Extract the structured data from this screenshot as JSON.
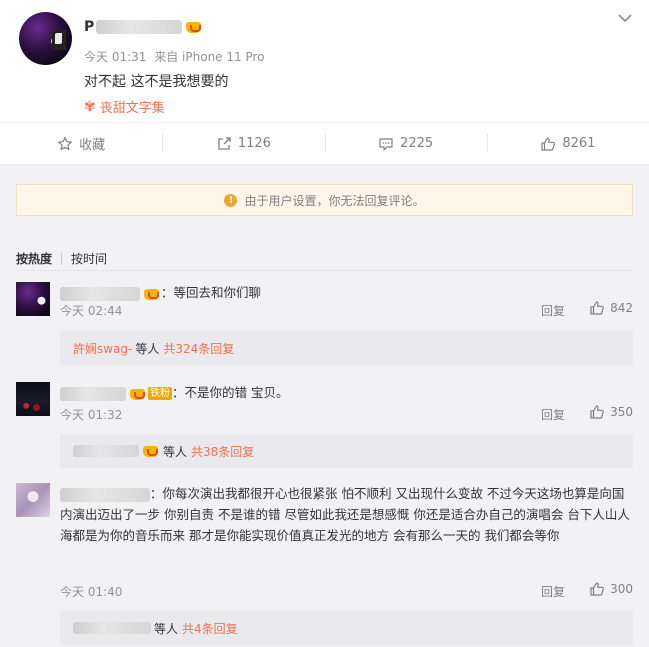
{
  "post": {
    "name_first_char": "P",
    "post_time": "今天 01:31",
    "post_source": "来自 iPhone 11 Pro",
    "text": "对不起 这不是我想要的",
    "topic": "丧甜文字集",
    "menu_icon": "chevron-down-icon"
  },
  "actions": {
    "favorite_label": "收藏",
    "repost_count": "1126",
    "comment_count": "2225",
    "like_count": "8261"
  },
  "notice": {
    "icon": "!",
    "text": "由于用户设置，你无法回复评论。"
  },
  "sort": {
    "hot_label": "按热度",
    "time_label": "按时间"
  },
  "comments": [
    {
      "text": "：等回去和你们聊",
      "time": "今天 02:44",
      "reply_label": "回复",
      "likes": "842",
      "sub_user": "許娴swag-",
      "sub_mid": "等人",
      "sub_count": "共324条回复"
    },
    {
      "badge": "铁粉",
      "text": "：不是你的错 宝贝。",
      "time": "今天 01:32",
      "reply_label": "回复",
      "likes": "350",
      "sub_mid": "等人",
      "sub_count": "共38条回复"
    },
    {
      "text": "：你每次演出我都很开心也很紧张 怕不顺利 又出现什么变故 不过今天这场也算是向国内演出迈出了一步 你别自责 不是谁的错 尽管如此我还是想感慨 你还是适合办自己的演唱会 台下人山人海都是为你的音乐而来 那才是你能实现价值真正发光的地方 会有那么一天的 我们都会等你",
      "time": "今天 01:40",
      "reply_label": "回复",
      "likes": "300",
      "sub_mid": "等人",
      "sub_count": "共4条回复"
    }
  ],
  "colors": {
    "accent": "#eb7350",
    "notice_bg": "#fdf6e9",
    "page_bg": "#f2f2f5"
  }
}
